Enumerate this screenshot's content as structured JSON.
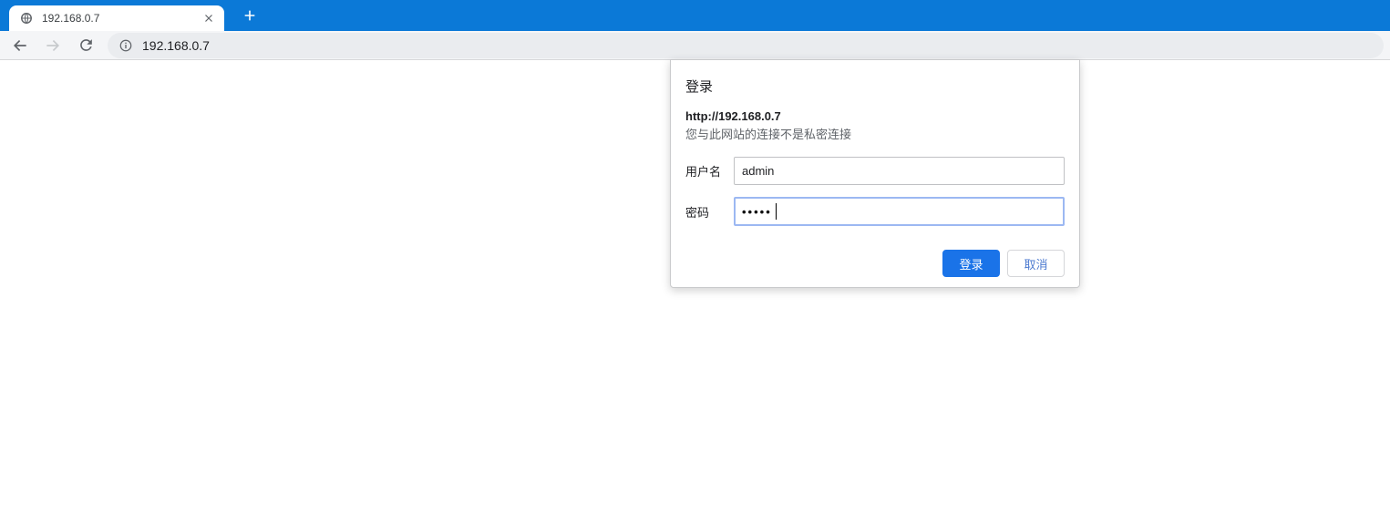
{
  "browser": {
    "tab": {
      "title": "192.168.0.7"
    },
    "toolbar": {
      "url": "192.168.0.7"
    },
    "colors": {
      "titlebar": "#0b79d7",
      "accent": "#1a73e8"
    }
  },
  "dialog": {
    "title": "登录",
    "origin": "http://192.168.0.7",
    "warning": "您与此网站的连接不是私密连接",
    "username": {
      "label": "用户名",
      "value": "admin"
    },
    "password": {
      "label": "密码",
      "mask": "•••••"
    },
    "buttons": {
      "signin": "登录",
      "cancel": "取消"
    }
  }
}
